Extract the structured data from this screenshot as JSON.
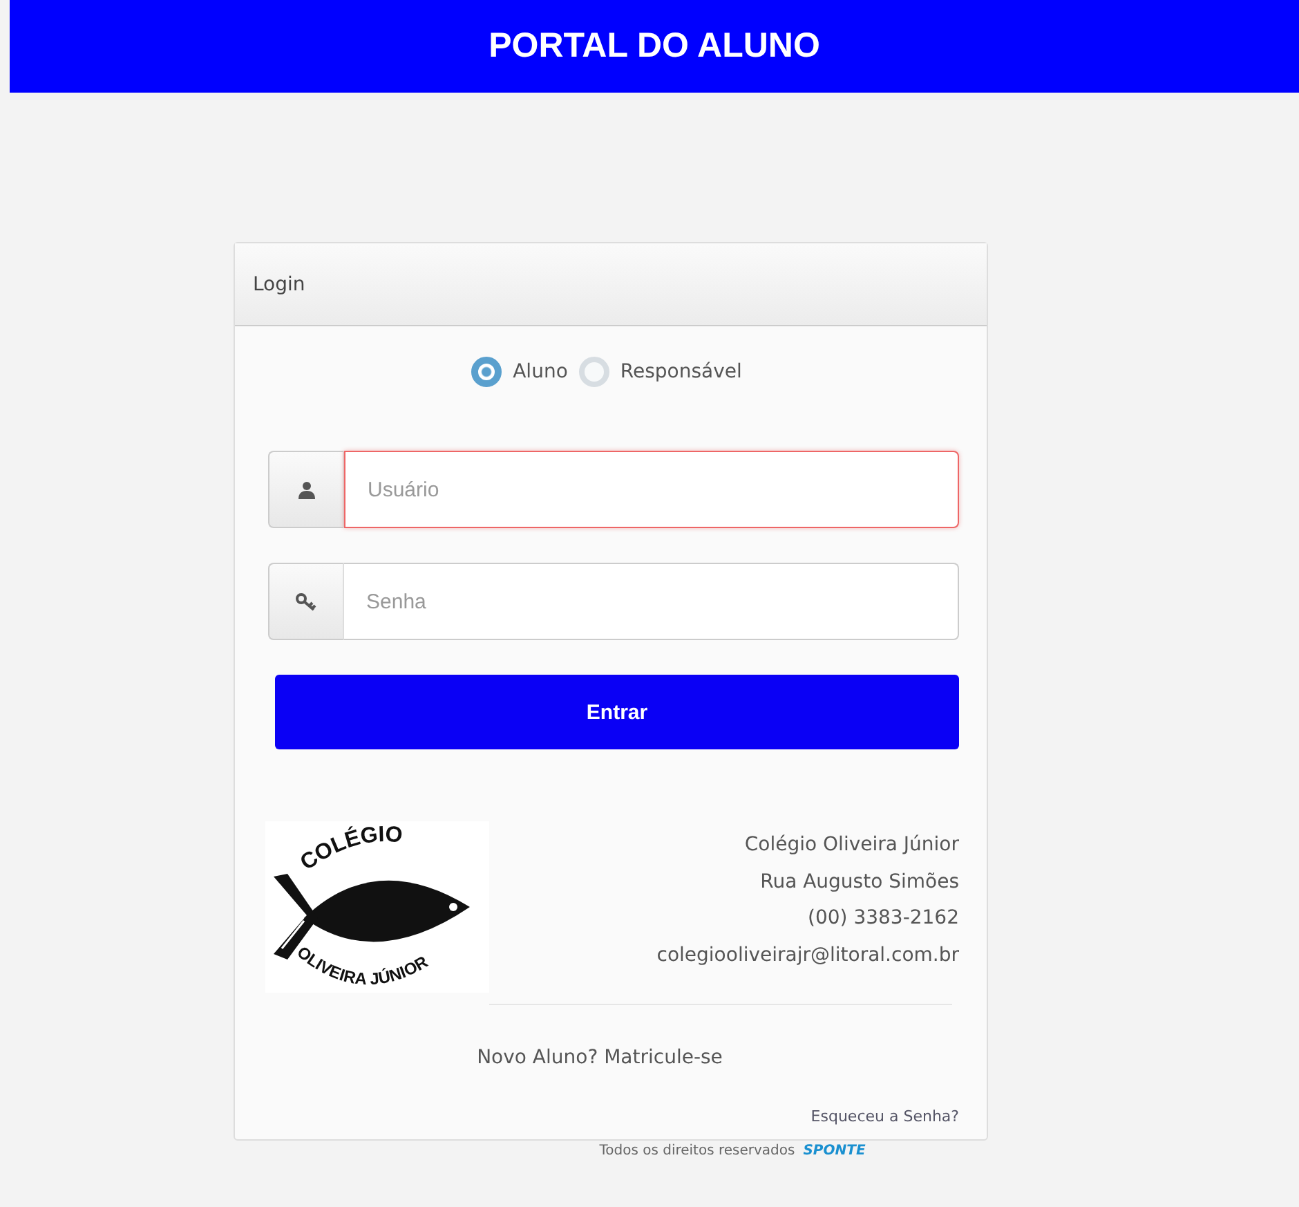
{
  "header": {
    "title": "PORTAL DO ALUNO"
  },
  "login_panel": {
    "title": "Login",
    "user_type": [
      {
        "label": "Aluno",
        "selected": true
      },
      {
        "label": "Responsável",
        "selected": false
      }
    ],
    "fields": [
      {
        "kind": "user",
        "placeholder": "Usuário",
        "error": true
      },
      {
        "kind": "password",
        "placeholder": "Senha",
        "error": false
      }
    ],
    "submit_button": "Entrar",
    "school_logo": {
      "top_text": "COLÉGIO",
      "bottom_text": "OLIVEIRA JÚNIOR"
    },
    "school_info": [
      "Colégio Oliveira Júnior",
      "Rua Augusto Simões",
      "(00) 3383-2162",
      "colegiooliveirajr@litoral.com.br"
    ],
    "signup_link": "Novo Aluno? Matricule-se",
    "forgot_link": "Esqueceu a Senha?"
  },
  "footer": {
    "text": "Todos os direitos reservados",
    "brand": "SPONTE"
  }
}
